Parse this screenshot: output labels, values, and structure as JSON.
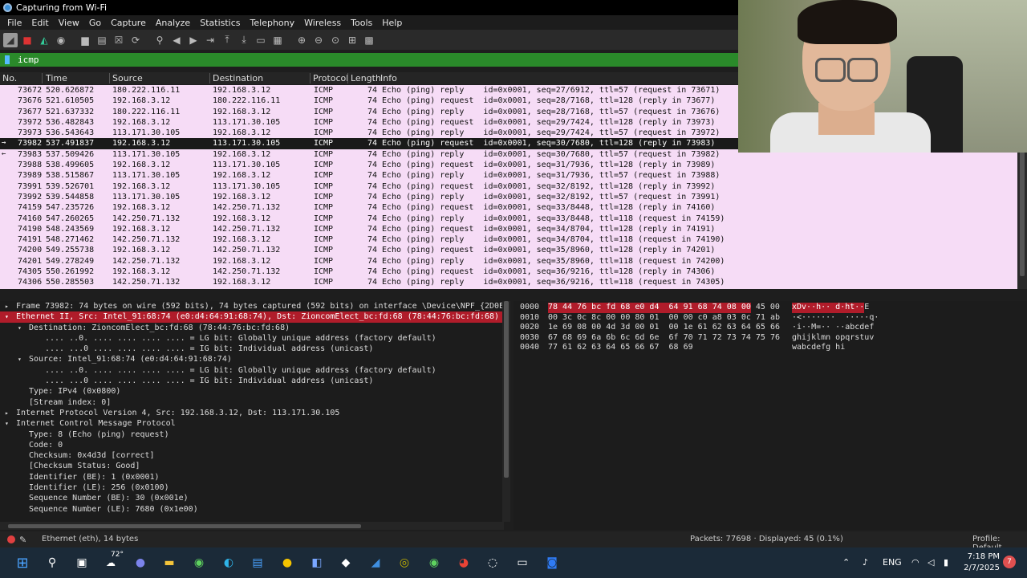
{
  "window": {
    "title": "Capturing from Wi-Fi"
  },
  "menu": [
    "File",
    "Edit",
    "View",
    "Go",
    "Capture",
    "Analyze",
    "Statistics",
    "Telephony",
    "Wireless",
    "Tools",
    "Help"
  ],
  "toolbar": [
    "shark-fin-icon",
    "stop-icon",
    "restart-icon",
    "options-icon",
    "open-icon",
    "save-icon",
    "close-file-icon",
    "reload-icon",
    "find-icon",
    "back-icon",
    "forward-icon",
    "goto-icon",
    "first-icon",
    "last-icon",
    "autoscroll-icon",
    "colorize-icon",
    "zoom-in-icon",
    "zoom-out-icon",
    "normal-size-icon",
    "resize-columns-icon"
  ],
  "filter": {
    "value": "icmp"
  },
  "columns": [
    "No.",
    "Time",
    "Source",
    "Destination",
    "Protocol",
    "Length",
    "Info"
  ],
  "packets": [
    {
      "no": "73672",
      "time": "520.626872",
      "src": "180.222.116.11",
      "dst": "192.168.3.12",
      "proto": "ICMP",
      "len": "74",
      "info": "Echo (ping) reply    id=0x0001, seq=27/6912, ttl=57 (request in 73671)",
      "mark": ""
    },
    {
      "no": "73676",
      "time": "521.610505",
      "src": "192.168.3.12",
      "dst": "180.222.116.11",
      "proto": "ICMP",
      "len": "74",
      "info": "Echo (ping) request  id=0x0001, seq=28/7168, ttl=128 (reply in 73677)",
      "mark": ""
    },
    {
      "no": "73677",
      "time": "521.637332",
      "src": "180.222.116.11",
      "dst": "192.168.3.12",
      "proto": "ICMP",
      "len": "74",
      "info": "Echo (ping) reply    id=0x0001, seq=28/7168, ttl=57 (request in 73676)",
      "mark": ""
    },
    {
      "no": "73972",
      "time": "536.482843",
      "src": "192.168.3.12",
      "dst": "113.171.30.105",
      "proto": "ICMP",
      "len": "74",
      "info": "Echo (ping) request  id=0x0001, seq=29/7424, ttl=128 (reply in 73973)",
      "mark": ""
    },
    {
      "no": "73973",
      "time": "536.543643",
      "src": "113.171.30.105",
      "dst": "192.168.3.12",
      "proto": "ICMP",
      "len": "74",
      "info": "Echo (ping) reply    id=0x0001, seq=29/7424, ttl=57 (request in 73972)",
      "mark": ""
    },
    {
      "no": "73982",
      "time": "537.491837",
      "src": "192.168.3.12",
      "dst": "113.171.30.105",
      "proto": "ICMP",
      "len": "74",
      "info": "Echo (ping) request  id=0x0001, seq=30/7680, ttl=128 (reply in 73983)",
      "mark": "→"
    },
    {
      "no": "73983",
      "time": "537.509426",
      "src": "113.171.30.105",
      "dst": "192.168.3.12",
      "proto": "ICMP",
      "len": "74",
      "info": "Echo (ping) reply    id=0x0001, seq=30/7680, ttl=57 (request in 73982)",
      "mark": "←"
    },
    {
      "no": "73988",
      "time": "538.499605",
      "src": "192.168.3.12",
      "dst": "113.171.30.105",
      "proto": "ICMP",
      "len": "74",
      "info": "Echo (ping) request  id=0x0001, seq=31/7936, ttl=128 (reply in 73989)",
      "mark": ""
    },
    {
      "no": "73989",
      "time": "538.515867",
      "src": "113.171.30.105",
      "dst": "192.168.3.12",
      "proto": "ICMP",
      "len": "74",
      "info": "Echo (ping) reply    id=0x0001, seq=31/7936, ttl=57 (request in 73988)",
      "mark": ""
    },
    {
      "no": "73991",
      "time": "539.526701",
      "src": "192.168.3.12",
      "dst": "113.171.30.105",
      "proto": "ICMP",
      "len": "74",
      "info": "Echo (ping) request  id=0x0001, seq=32/8192, ttl=128 (reply in 73992)",
      "mark": ""
    },
    {
      "no": "73992",
      "time": "539.544858",
      "src": "113.171.30.105",
      "dst": "192.168.3.12",
      "proto": "ICMP",
      "len": "74",
      "info": "Echo (ping) reply    id=0x0001, seq=32/8192, ttl=57 (request in 73991)",
      "mark": ""
    },
    {
      "no": "74159",
      "time": "547.235726",
      "src": "192.168.3.12",
      "dst": "142.250.71.132",
      "proto": "ICMP",
      "len": "74",
      "info": "Echo (ping) request  id=0x0001, seq=33/8448, ttl=128 (reply in 74160)",
      "mark": ""
    },
    {
      "no": "74160",
      "time": "547.260265",
      "src": "142.250.71.132",
      "dst": "192.168.3.12",
      "proto": "ICMP",
      "len": "74",
      "info": "Echo (ping) reply    id=0x0001, seq=33/8448, ttl=118 (request in 74159)",
      "mark": ""
    },
    {
      "no": "74190",
      "time": "548.243569",
      "src": "192.168.3.12",
      "dst": "142.250.71.132",
      "proto": "ICMP",
      "len": "74",
      "info": "Echo (ping) request  id=0x0001, seq=34/8704, ttl=128 (reply in 74191)",
      "mark": ""
    },
    {
      "no": "74191",
      "time": "548.271462",
      "src": "142.250.71.132",
      "dst": "192.168.3.12",
      "proto": "ICMP",
      "len": "74",
      "info": "Echo (ping) reply    id=0x0001, seq=34/8704, ttl=118 (request in 74190)",
      "mark": ""
    },
    {
      "no": "74200",
      "time": "549.255738",
      "src": "192.168.3.12",
      "dst": "142.250.71.132",
      "proto": "ICMP",
      "len": "74",
      "info": "Echo (ping) request  id=0x0001, seq=35/8960, ttl=128 (reply in 74201)",
      "mark": ""
    },
    {
      "no": "74201",
      "time": "549.278249",
      "src": "142.250.71.132",
      "dst": "192.168.3.12",
      "proto": "ICMP",
      "len": "74",
      "info": "Echo (ping) reply    id=0x0001, seq=35/8960, ttl=118 (request in 74200)",
      "mark": ""
    },
    {
      "no": "74305",
      "time": "550.261992",
      "src": "192.168.3.12",
      "dst": "142.250.71.132",
      "proto": "ICMP",
      "len": "74",
      "info": "Echo (ping) request  id=0x0001, seq=36/9216, ttl=128 (reply in 74306)",
      "mark": ""
    },
    {
      "no": "74306",
      "time": "550.285503",
      "src": "142.250.71.132",
      "dst": "192.168.3.12",
      "proto": "ICMP",
      "len": "74",
      "info": "Echo (ping) reply    id=0x0001, seq=36/9216, ttl=118 (request in 74305)",
      "mark": ""
    }
  ],
  "selected_packet": "73982",
  "details": [
    {
      "indent": 0,
      "tw": "▸",
      "text": "Frame 73982: 74 bytes on wire (592 bits), 74 bytes captured (592 bits) on interface \\Device\\NPF_{2D0E8",
      "hl": false
    },
    {
      "indent": 0,
      "tw": "▾",
      "text": "Ethernet II, Src: Intel_91:68:74 (e0:d4:64:91:68:74), Dst: ZioncomElect_bc:fd:68 (78:44:76:bc:fd:68)",
      "hl": true
    },
    {
      "indent": 1,
      "tw": "▾",
      "text": "Destination: ZioncomElect_bc:fd:68 (78:44:76:bc:fd:68)",
      "hl": false
    },
    {
      "indent": 2,
      "tw": "",
      "text": ".... ..0. .... .... .... .... = LG bit: Globally unique address (factory default)",
      "hl": false
    },
    {
      "indent": 2,
      "tw": "",
      "text": ".... ...0 .... .... .... .... = IG bit: Individual address (unicast)",
      "hl": false
    },
    {
      "indent": 1,
      "tw": "▾",
      "text": "Source: Intel_91:68:74 (e0:d4:64:91:68:74)",
      "hl": false
    },
    {
      "indent": 2,
      "tw": "",
      "text": ".... ..0. .... .... .... .... = LG bit: Globally unique address (factory default)",
      "hl": false
    },
    {
      "indent": 2,
      "tw": "",
      "text": ".... ...0 .... .... .... .... = IG bit: Individual address (unicast)",
      "hl": false
    },
    {
      "indent": 1,
      "tw": "",
      "text": "Type: IPv4 (0x0800)",
      "hl": false
    },
    {
      "indent": 1,
      "tw": "",
      "text": "[Stream index: 0]",
      "hl": false
    },
    {
      "indent": 0,
      "tw": "▸",
      "text": "Internet Protocol Version 4, Src: 192.168.3.12, Dst: 113.171.30.105",
      "hl": false
    },
    {
      "indent": 0,
      "tw": "▾",
      "text": "Internet Control Message Protocol",
      "hl": false
    },
    {
      "indent": 1,
      "tw": "",
      "text": "Type: 8 (Echo (ping) request)",
      "hl": false
    },
    {
      "indent": 1,
      "tw": "",
      "text": "Code: 0",
      "hl": false
    },
    {
      "indent": 1,
      "tw": "",
      "text": "Checksum: 0x4d3d [correct]",
      "hl": false
    },
    {
      "indent": 1,
      "tw": "",
      "text": "[Checksum Status: Good]",
      "hl": false
    },
    {
      "indent": 1,
      "tw": "",
      "text": "Identifier (BE): 1 (0x0001)",
      "hl": false
    },
    {
      "indent": 1,
      "tw": "",
      "text": "Identifier (LE): 256 (0x0100)",
      "hl": false
    },
    {
      "indent": 1,
      "tw": "",
      "text": "Sequence Number (BE): 30 (0x001e)",
      "hl": false
    },
    {
      "indent": 1,
      "tw": "",
      "text": "Sequence Number (LE): 7680 (0x1e00)",
      "hl": false
    }
  ],
  "hex": [
    {
      "offset": "0000",
      "hl_hex": "78 44 76 bc fd 68 e0 d4  64 91 68 74 08 00",
      "hex": " 45 00",
      "hl_ascii": "xDv··h·· d·ht··",
      "ascii": "E"
    },
    {
      "offset": "0010",
      "hl_hex": "",
      "hex": "00 3c 0c 8c 00 00 80 01  00 00 c0 a8 03 0c 71 ab",
      "hl_ascii": "",
      "ascii": "·<·······  ·····q·"
    },
    {
      "offset": "0020",
      "hl_hex": "",
      "hex": "1e 69 08 00 4d 3d 00 01  00 1e 61 62 63 64 65 66",
      "hl_ascii": "",
      "ascii": "·i··M=·· ··abcdef"
    },
    {
      "offset": "0030",
      "hl_hex": "",
      "hex": "67 68 69 6a 6b 6c 6d 6e  6f 70 71 72 73 74 75 76",
      "hl_ascii": "",
      "ascii": "ghijklmn opqrstuv"
    },
    {
      "offset": "0040",
      "hl_hex": "",
      "hex": "77 61 62 63 64 65 66 67  68 69",
      "hl_ascii": "",
      "ascii": "wabcdefg hi"
    }
  ],
  "status": {
    "left": "Ethernet (eth), 14 bytes",
    "packets": "Packets: 77698 · Displayed: 45 (0.1%)",
    "profile": "Profile: Default"
  },
  "taskbar": {
    "weather": "72°",
    "lang": "ENG",
    "time": "7:18 PM",
    "date": "2/7/2025",
    "notifications": "7"
  },
  "colors": {
    "packet_row_bg": "#f6dcf6",
    "selection_bg": "#1a1a1a",
    "highlight_red": "#b01c2a",
    "filter_green": "#2a8a2a"
  }
}
